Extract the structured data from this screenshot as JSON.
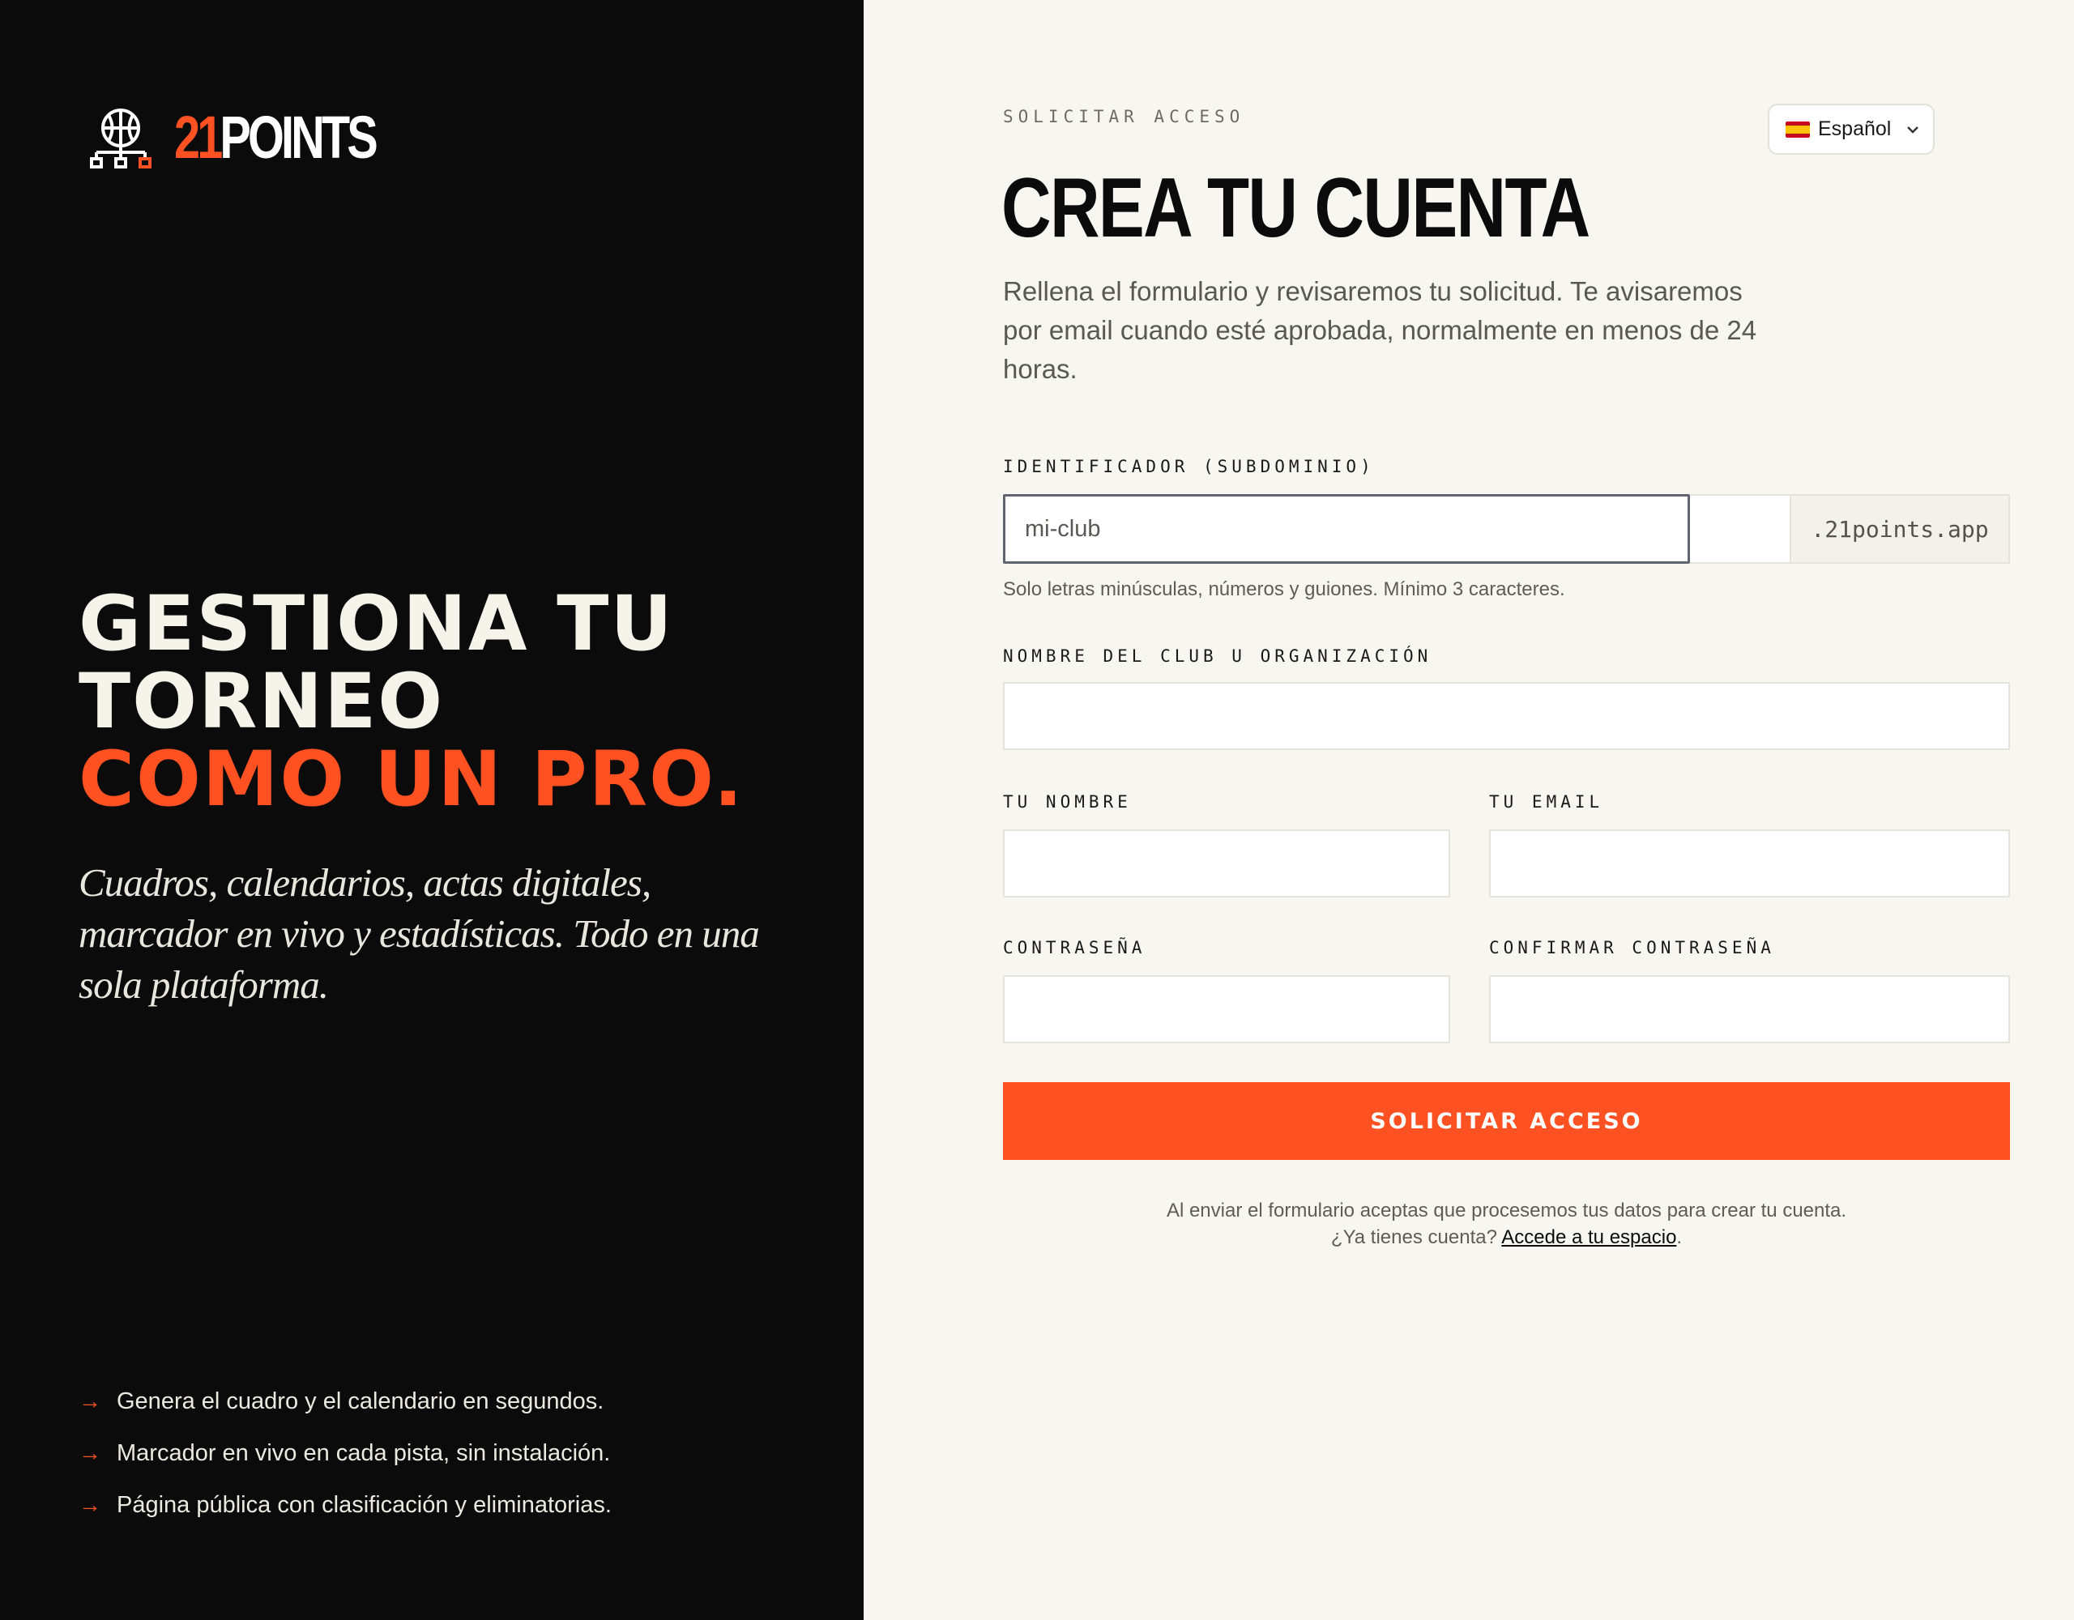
{
  "brand": {
    "number": "21",
    "word": "POINTS"
  },
  "hero": {
    "line1": "GESTIONA TU",
    "line2": "TORNEO",
    "line3": "COMO UN PRO.",
    "tagline": "Cuadros, calendarios, actas digitales, marcador en vivo y estadísticas. Todo en una sola plataforma."
  },
  "features": [
    {
      "arrow": "→",
      "text": "Genera el cuadro y el calendario en segundos."
    },
    {
      "arrow": "→",
      "text": "Marcador en vivo en cada pista, sin instalación."
    },
    {
      "arrow": "→",
      "text": "Página pública con clasificación y eliminatorias."
    }
  ],
  "language": {
    "selected": "Español"
  },
  "form": {
    "eyebrow": "SOLICITAR ACCESO",
    "title": "CREA TU CUENTA",
    "subtitle": "Rellena el formulario y revisaremos tu solicitud. Te avisaremos por email cuando esté aprobada, normalmente en menos de 24 horas.",
    "subdomain_label": "IDENTIFICADOR (SUBDOMINIO)",
    "subdomain_placeholder": "mi-club",
    "subdomain_suffix": ".21points.app",
    "subdomain_help": "Solo letras minúsculas, números y guiones. Mínimo 3 caracteres.",
    "club_label": "NOMBRE DEL CLUB U ORGANIZACIÓN",
    "name_label": "TU NOMBRE",
    "email_label": "TU EMAIL",
    "password_label": "CONTRASEÑA",
    "confirm_label": "CONFIRMAR CONTRASEÑA",
    "submit_label": "SOLICITAR ACCESO",
    "legal_text": "Al enviar el formulario aceptas que procesemos tus datos para crear tu cuenta.",
    "login_prompt": "¿Ya tienes cuenta?",
    "login_link": "Accede a tu espacio",
    "login_period": "."
  },
  "colors": {
    "accent": "#ff5122",
    "dark": "#0b0b0b",
    "light": "#f8f6f1"
  }
}
